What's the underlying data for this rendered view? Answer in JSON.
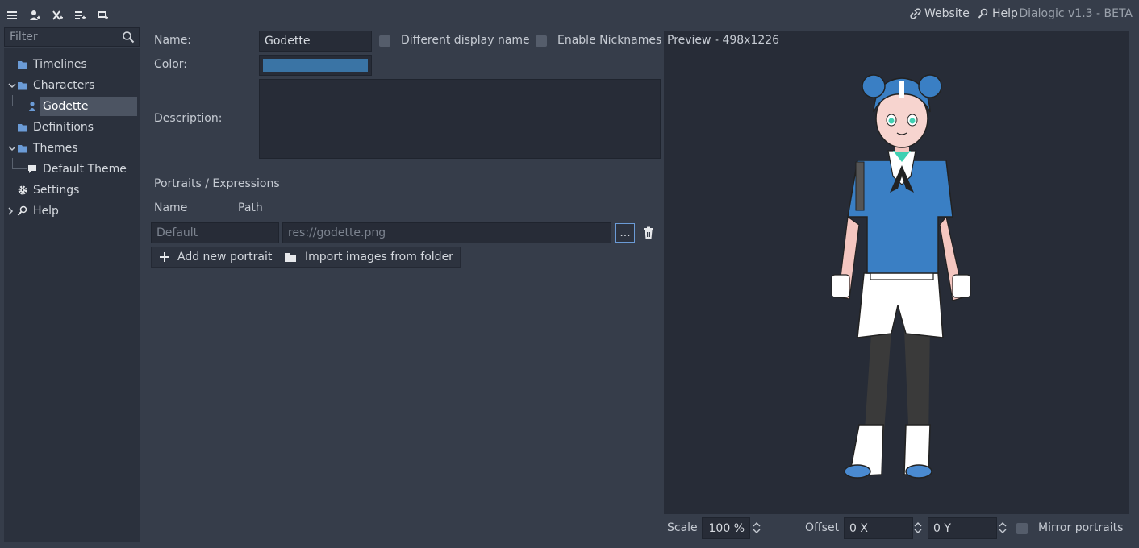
{
  "toolbar": {
    "icons": [
      "menu-icon",
      "add-character-icon",
      "add-timeline-icon",
      "add-definition-icon",
      "add-theme-icon"
    ]
  },
  "top_links": {
    "website": "Website",
    "help": "Help",
    "version": "Dialogic v1.3 - BETA"
  },
  "sidebar": {
    "filter_placeholder": "Filter",
    "items": [
      {
        "label": "Timelines"
      },
      {
        "label": "Characters"
      },
      {
        "label": "Godette"
      },
      {
        "label": "Definitions"
      },
      {
        "label": "Themes"
      },
      {
        "label": "Default Theme"
      },
      {
        "label": "Settings"
      },
      {
        "label": "Help"
      }
    ]
  },
  "character": {
    "name_label": "Name:",
    "name_value": "Godette",
    "different_display_name": "Different display name",
    "enable_nicknames": "Enable Nicknames",
    "color_label": "Color:",
    "color_value": "#3a74a5",
    "description_label": "Description:",
    "description_value": ""
  },
  "portraits": {
    "section_title": "Portraits / Expressions",
    "col_name": "Name",
    "col_path": "Path",
    "row_name_placeholder": "Default",
    "row_path_placeholder": "res://godette.png",
    "browse_label": "...",
    "add_button": "Add new portrait",
    "import_button": "Import images from folder"
  },
  "preview": {
    "title": "Preview - 498x1226",
    "scale_label": "Scale",
    "scale_value": "100 %",
    "offset_label": "Offset",
    "offset_x": "0 X",
    "offset_y": "0 Y",
    "mirror_label": "Mirror portraits"
  },
  "colors": {
    "accent": "#6b9bd6",
    "bg": "#363d4a",
    "panel": "#2b313d"
  }
}
